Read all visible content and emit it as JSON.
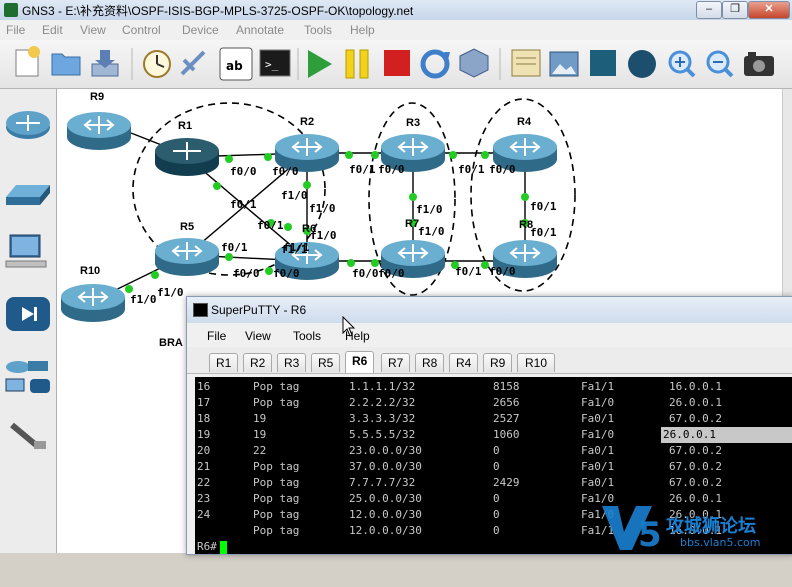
{
  "window": {
    "title": "GNS3 - E:\\补充资料\\OSPF-ISIS-BGP-MPLS-3725-OSPF-OK\\topology.net",
    "controls": [
      "–",
      "❐",
      "✕"
    ]
  },
  "menu": [
    "File",
    "Edit",
    "View",
    "Control",
    "Device",
    "Annotate",
    "Tools",
    "Help"
  ],
  "toolbar": [
    {
      "name": "new-project-icon",
      "color": "#f2c94c"
    },
    {
      "name": "open-project-icon",
      "color": "#6ea6e0"
    },
    {
      "name": "save-project-icon",
      "color": "#7f9fc7"
    },
    {
      "name": "snapshot-clock-icon",
      "color": "#c9a54a"
    },
    {
      "name": "add-link-icon",
      "color": "#6b8fc0"
    },
    {
      "name": "show-interface-labels-icon",
      "color": "#ffffff"
    },
    {
      "name": "console-all-icon",
      "color": "#1b1b1b"
    },
    {
      "name": "start-all-icon",
      "color": "#2e9e3b"
    },
    {
      "name": "suspend-all-icon",
      "color": "#f2d21b"
    },
    {
      "name": "stop-all-icon",
      "color": "#d21f1f"
    },
    {
      "name": "reload-all-icon",
      "color": "#3f7fc9"
    },
    {
      "name": "virtualbox-icon",
      "color": "#6f8db5"
    },
    {
      "name": "add-note-icon",
      "color": "#e8d9a0"
    },
    {
      "name": "insert-picture-icon",
      "color": "#6f9bc6"
    },
    {
      "name": "draw-rectangle-icon",
      "color": "#1d5e7a"
    },
    {
      "name": "draw-ellipse-icon",
      "color": "#1c4e6e"
    },
    {
      "name": "zoom-in-icon",
      "color": "#4a90d9"
    },
    {
      "name": "zoom-out-icon",
      "color": "#4a90d9"
    },
    {
      "name": "screenshot-icon",
      "color": "#333333"
    }
  ],
  "dock": [
    "routers-icon",
    "switches-icon",
    "end-devices-icon",
    "security-devices-icon",
    "all-devices-icon",
    "add-link-cable-icon"
  ],
  "topology": {
    "routers": [
      {
        "id": "R9",
        "label": "R9"
      },
      {
        "id": "R1",
        "label": "R1"
      },
      {
        "id": "R2",
        "label": "R2"
      },
      {
        "id": "R3",
        "label": "R3"
      },
      {
        "id": "R4",
        "label": "R4"
      },
      {
        "id": "R5",
        "label": "R5"
      },
      {
        "id": "R6",
        "label": "R6"
      },
      {
        "id": "R7",
        "label": "R7"
      },
      {
        "id": "R8",
        "label": "R8"
      },
      {
        "id": "R10",
        "label": "R10"
      }
    ],
    "ifaces": [
      "f0/0",
      "f0/0",
      "f1/0",
      "f0/1",
      "f1/0",
      "f0/1",
      "f1/1",
      "f0/1",
      "f0/0",
      "f0/1",
      "f0/0",
      "f1/0",
      "f1/0",
      "f0/1",
      "f1/0",
      "f0/1",
      "f1/1",
      "f0/0",
      "f0/0",
      "f0/1",
      "f0/0",
      "f0/1",
      "f0/0",
      "f1/0",
      "f0/0",
      "f1/0"
    ],
    "partial_label": "BRA"
  },
  "putty": {
    "title": "SuperPuTTY - R6",
    "menu": [
      "File",
      "View",
      "Tools",
      "Help"
    ],
    "tabs": [
      "R1",
      "R2",
      "R3",
      "R5",
      "R6",
      "R7",
      "R8",
      "R4",
      "R9",
      "R10"
    ],
    "active_tab": "R6",
    "rows": [
      {
        "label": "16",
        "out": "Pop tag",
        "prefix": "1.1.1.1/32",
        "bytes": "8158",
        "intf": "Fa1/1",
        "next_hop": "16.0.0.1"
      },
      {
        "label": "17",
        "out": "Pop tag",
        "prefix": "2.2.2.2/32",
        "bytes": "2656",
        "intf": "Fa1/0",
        "next_hop": "26.0.0.1"
      },
      {
        "label": "18",
        "out": "19",
        "prefix": "3.3.3.3/32",
        "bytes": "2527",
        "intf": "Fa0/1",
        "next_hop": "67.0.0.2"
      },
      {
        "label": "19",
        "out": "19",
        "prefix": "5.5.5.5/32",
        "bytes": "1060",
        "intf": "Fa1/0",
        "next_hop": "26.0.0.1"
      },
      {
        "label": "20",
        "out": "22",
        "prefix": "23.0.0.0/30",
        "bytes": "0",
        "intf": "Fa0/1",
        "next_hop": "67.0.0.2"
      },
      {
        "label": "21",
        "out": "Pop tag",
        "prefix": "37.0.0.0/30",
        "bytes": "0",
        "intf": "Fa0/1",
        "next_hop": "67.0.0.2"
      },
      {
        "label": "22",
        "out": "Pop tag",
        "prefix": "7.7.7.7/32",
        "bytes": "2429",
        "intf": "Fa0/1",
        "next_hop": "67.0.0.2"
      },
      {
        "label": "23",
        "out": "Pop tag",
        "prefix": "25.0.0.0/30",
        "bytes": "0",
        "intf": "Fa1/0",
        "next_hop": "26.0.0.1"
      },
      {
        "label": "24",
        "out": "Pop tag",
        "prefix": "12.0.0.0/30",
        "bytes": "0",
        "intf": "Fa1/0",
        "next_hop": "26.0.0.1"
      },
      {
        "label": "",
        "out": "Pop tag",
        "prefix": "12.0.0.0/30",
        "bytes": "0",
        "intf": "Fa1/1",
        "next_hop": "16.0.0.1"
      }
    ],
    "prompt": "R6#"
  },
  "watermark": {
    "text": "攻城狮论坛",
    "sub": "bbs.vlan5.com"
  }
}
